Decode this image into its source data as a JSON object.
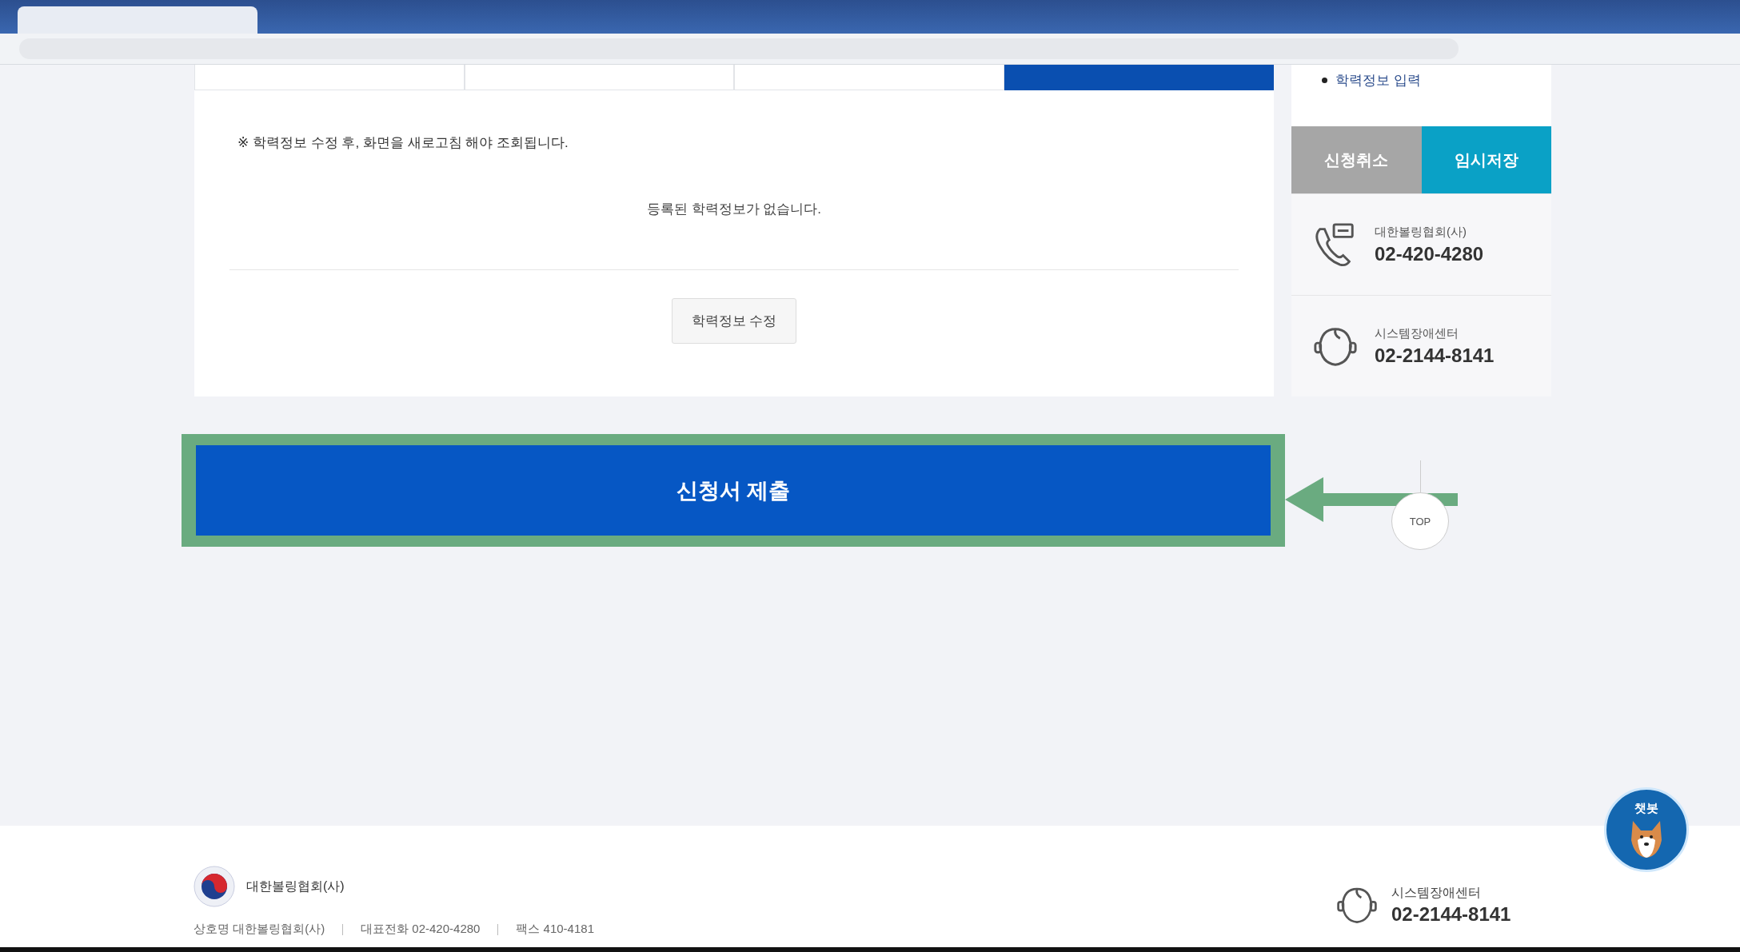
{
  "form_tabs": [
    {
      "selected": false
    },
    {
      "selected": false
    },
    {
      "selected": false
    },
    {
      "selected": true
    }
  ],
  "notice": "※ 학력정보 수정 후, 화면을 새로고침 해야 조회됩니다.",
  "empty_message": "등록된 학력정보가 없습니다.",
  "edit_button": "학력정보 수정",
  "submit_button": {
    "label": "신청서 제출",
    "highlighted": true
  },
  "sidebar": {
    "links": [
      {
        "label": "학력정보 입력"
      }
    ],
    "buttons": [
      {
        "label": "신청취소",
        "kind": "secondary"
      },
      {
        "label": "임시저장",
        "kind": "primary"
      }
    ],
    "contacts": [
      {
        "kind": "phone",
        "name": "대한볼링협회(사)",
        "number": "02-420-4280"
      },
      {
        "kind": "headset",
        "name": "시스템장애센터",
        "number": "02-2144-8141"
      }
    ]
  },
  "top_button": "TOP",
  "chat_button": "챗봇",
  "footer": {
    "org": "대한볼링협회(사)",
    "info": [
      "상호명 대한볼링협회(사)",
      "대표전화 02-420-4280",
      "팩스 410-4181"
    ],
    "contact": {
      "kind": "headset",
      "name": "시스템장애센터",
      "number": "02-2144-8141"
    }
  }
}
